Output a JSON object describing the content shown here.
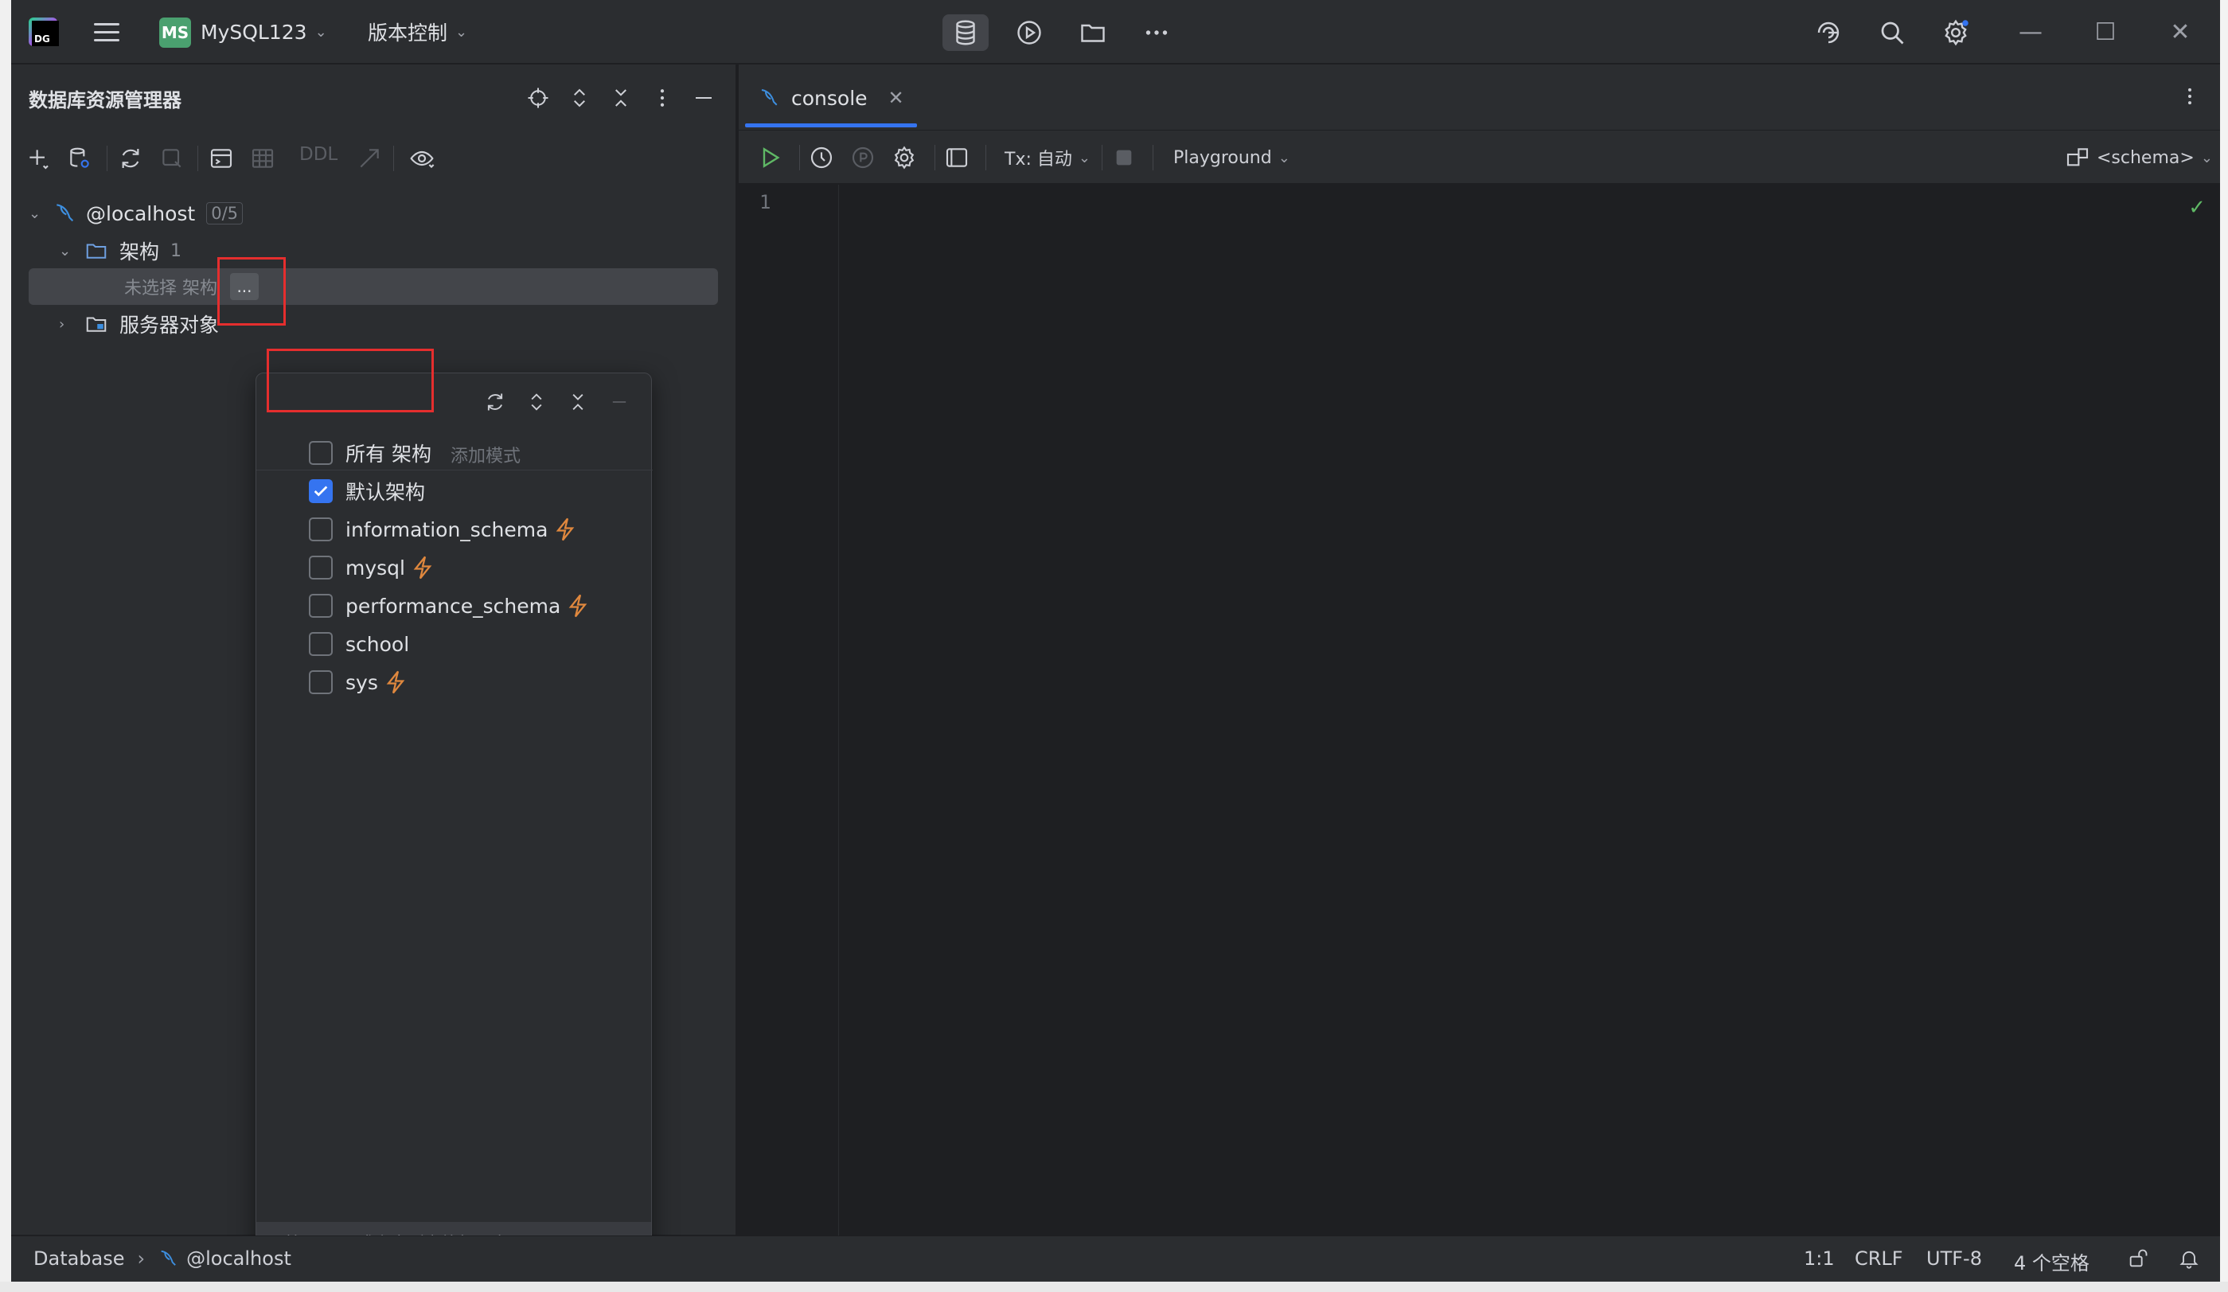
{
  "titlebar": {
    "project_badge": "MS",
    "project_name": "MySQL123",
    "vcs_label": "版本控制",
    "colors": {
      "badge": "#4aa06f",
      "active_icon_bg": "#43454a"
    }
  },
  "db_explorer": {
    "title": "数据库资源管理器",
    "toolbar": {
      "ddl_label": "DDL"
    },
    "tree": {
      "host": "@localhost",
      "host_count": "0/5",
      "schemas_label": "架构",
      "schemas_count": "1",
      "unselected_hint": "未选择 架构",
      "ellipsis": "...",
      "server_objects": "服务器对象"
    }
  },
  "schema_popup": {
    "add_mode_hint": "添加模式",
    "footer": "按 Enter 或点击列表外部以应用",
    "items": [
      {
        "label": "所有 架构",
        "checked": false,
        "introspect_icon": false
      },
      {
        "label": "默认架构",
        "checked": true,
        "introspect_icon": false
      },
      {
        "label": "information_schema",
        "checked": false,
        "introspect_icon": true
      },
      {
        "label": "mysql",
        "checked": false,
        "introspect_icon": true
      },
      {
        "label": "performance_schema",
        "checked": false,
        "introspect_icon": true
      },
      {
        "label": "school",
        "checked": false,
        "introspect_icon": false
      },
      {
        "label": "sys",
        "checked": false,
        "introspect_icon": true
      }
    ],
    "colors": {
      "checkbox_checked": "#3574f0",
      "bolt": "#e0883e",
      "highlight_box": "#e52e2e"
    }
  },
  "editor": {
    "tab_label": "console",
    "tx_label": "Tx: 自动",
    "playground_label": "Playground",
    "schema_label": "<schema>",
    "line_number": "1"
  },
  "statusbar": {
    "breadcrumb_root": "Database",
    "breadcrumb_host": "@localhost",
    "position": "1:1",
    "line_sep": "CRLF",
    "encoding": "UTF-8",
    "indent": "4 个空格"
  }
}
